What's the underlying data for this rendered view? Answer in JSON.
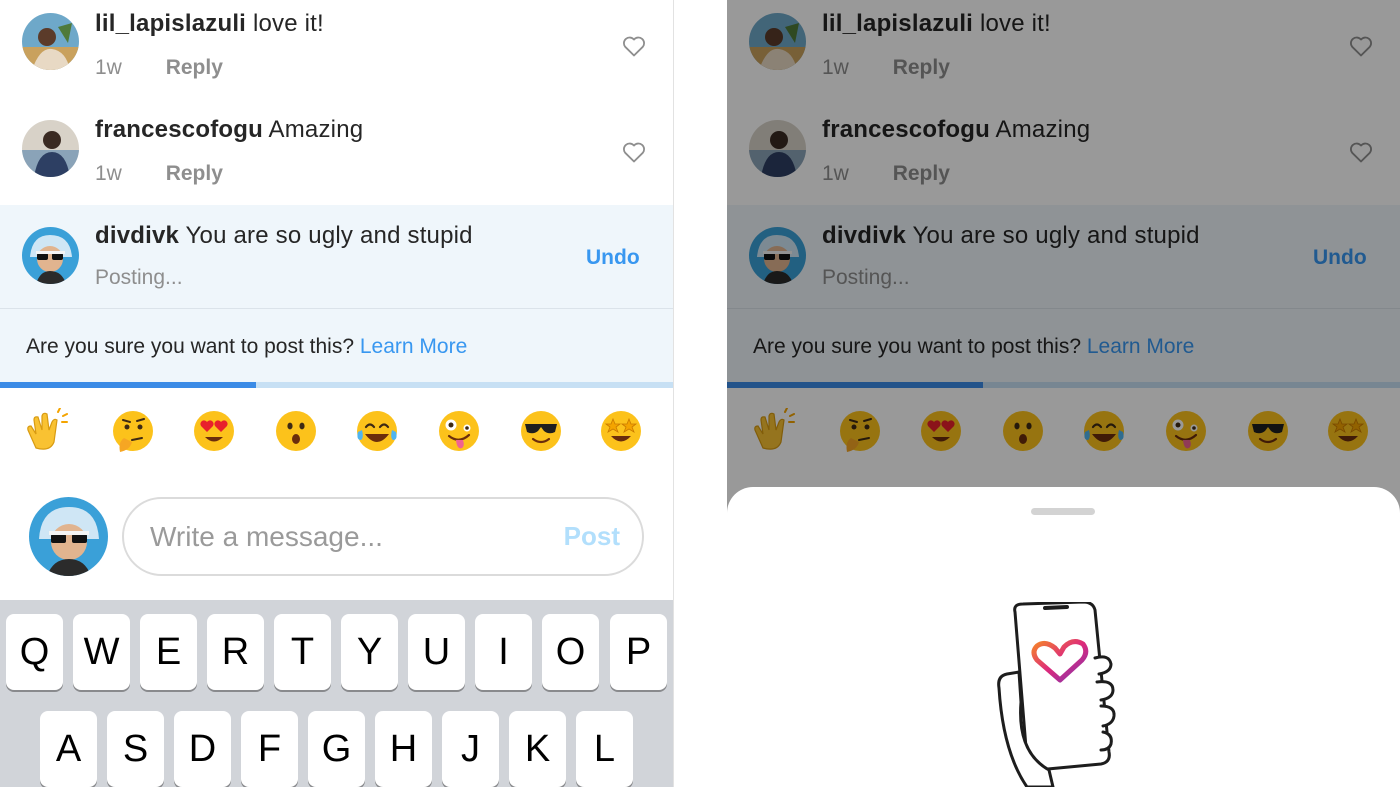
{
  "left_panel": {
    "comments": [
      {
        "username": "lil_lapislazuli",
        "text": "love it!",
        "age": "1w",
        "reply_label": "Reply"
      },
      {
        "username": "francescofogu",
        "text": "Amazing",
        "age": "1w",
        "reply_label": "Reply"
      }
    ],
    "pending_comment": {
      "username": "divdivk",
      "text": "You are so ugly and stupid",
      "status": "Posting...",
      "undo_label": "Undo"
    },
    "warning": {
      "text": "Are you sure you want to post this?",
      "link": "Learn More"
    },
    "progress_fraction": 0.38,
    "emojis": [
      "clapping-hands",
      "thinking-face",
      "heart-eyes",
      "surprised-face",
      "tears-of-joy",
      "zany-face",
      "sunglasses-face",
      "star-struck"
    ],
    "compose": {
      "placeholder": "Write a message...",
      "post_label": "Post"
    },
    "keyboard": {
      "row1": [
        "Q",
        "W",
        "E",
        "R",
        "T",
        "Y",
        "U",
        "I",
        "O",
        "P"
      ],
      "row2": [
        "A",
        "S",
        "D",
        "F",
        "G",
        "H",
        "J",
        "K",
        "L"
      ]
    }
  },
  "right_panel": {
    "comments": [
      {
        "username": "lil_lapislazuli",
        "text": "love it!",
        "age": "1w",
        "reply_label": "Reply"
      },
      {
        "username": "francescofogu",
        "text": "Amazing",
        "age": "1w",
        "reply_label": "Reply"
      }
    ],
    "pending_comment": {
      "username": "divdivk",
      "text": "You are so ugly and stupid",
      "status": "Posting...",
      "undo_label": "Undo"
    },
    "warning": {
      "text": "Are you sure you want to post this?",
      "link": "Learn More"
    },
    "progress_fraction": 0.38,
    "emojis": [
      "clapping-hands",
      "thinking-face",
      "heart-eyes",
      "surprised-face",
      "tears-of-joy",
      "zany-face",
      "sunglasses-face",
      "star-struck"
    ],
    "sheet_illustration": "hand-holding-phone-heart-icon"
  },
  "colors": {
    "accent_blue": "#3897f0",
    "pending_bg": "#eff6fb",
    "progress": "#3b8be6",
    "progress_track": "#c7e0f4",
    "post_disabled": "#b2dffc",
    "keyboard_bg": "#d1d4d9"
  }
}
